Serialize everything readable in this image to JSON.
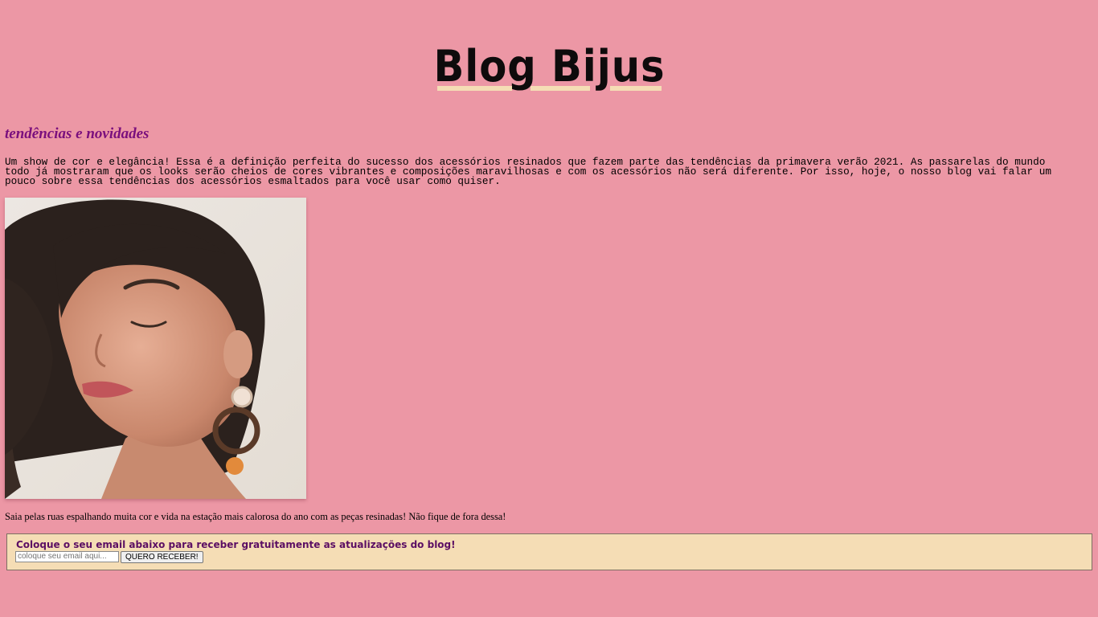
{
  "header": {
    "logo_text": "Blog Bijus",
    "logo_underline_color": "#f5ddb5"
  },
  "article": {
    "title": "tendências e novidades",
    "intro": "Um show de cor e elegância! Essa é a definição perfeita do sucesso dos acessórios resinados que fazem parte das tendências da primavera verão 2021. As passarelas do mundo todo já mostraram que os looks serão cheios de cores vibrantes e composições maravilhosas e com os acessórios não será diferente. Por isso, hoje, o nosso blog vai falar um pouco sobre essa tendências dos acessórios esmaltados para você usar como quiser.",
    "caption": "Saia pelas ruas espalhando muita cor e vida na estação mais calorosa do ano com as peças resinadas! Não fique de fora dessa!"
  },
  "newsletter": {
    "title": "Coloque o seu email abaixo para receber gratuitamente as atualizações do blog!",
    "email_placeholder": "coloque seu email aqui...",
    "email_value": "",
    "submit_label": "QUERO RECEBER!"
  },
  "colors": {
    "background": "#ec97a5",
    "title_purple": "#7a0f7d",
    "newsletter_bg": "#f5ddb5",
    "newsletter_title": "#5b0e63"
  }
}
